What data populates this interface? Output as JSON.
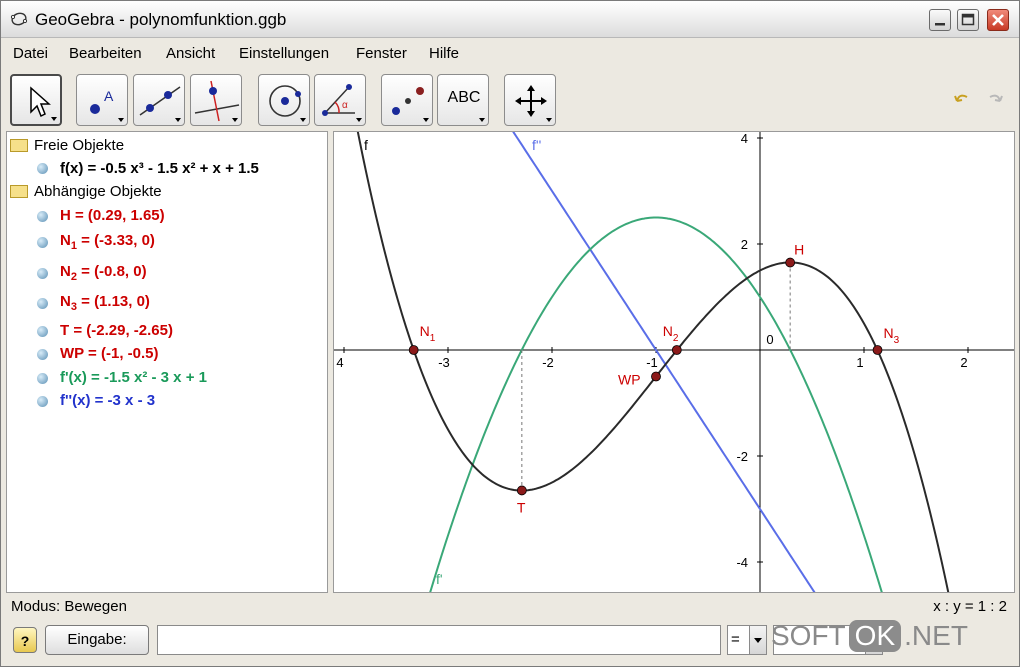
{
  "window": {
    "title": "GeoGebra - polynomfunktion.ggb",
    "controls": [
      "minimize-icon",
      "maximize-icon",
      "close-icon"
    ]
  },
  "menu": [
    "Datei",
    "Bearbeiten",
    "Ansicht",
    "Einstellungen",
    "Fenster",
    "Hilfe"
  ],
  "toolbar": {
    "tools": [
      {
        "icon": "move-arrow-icon"
      },
      {
        "icon": "new-point-icon"
      },
      {
        "icon": "line-through-two-points-icon"
      },
      {
        "icon": "perpendicular-line-icon"
      },
      {
        "icon": "circle-with-center-icon"
      },
      {
        "icon": "angle-icon"
      },
      {
        "icon": "reflect-about-point-icon"
      },
      {
        "icon": "text-icon",
        "label": "ABC"
      },
      {
        "icon": "move-graphics-view-icon"
      }
    ],
    "undo_icon": "undo-icon",
    "redo_icon": "redo-icon"
  },
  "algebra": {
    "free_header": "Freie Objekte",
    "dependent_header": "Abhängige Objekte",
    "free": [
      {
        "name": "f",
        "text": "f(x) = -0.5 x³ - 1.5 x² + x + 1.5",
        "color": "#000000"
      }
    ],
    "dependent": [
      {
        "text": "H = (0.29, 1.65)",
        "color": "#cc0000"
      },
      {
        "text": "N",
        "sub": "1",
        "rest": " = (-3.33, 0)",
        "color": "#cc0000"
      },
      {
        "text": "N",
        "sub": "2",
        "rest": " = (-0.8, 0)",
        "color": "#cc0000"
      },
      {
        "text": "N",
        "sub": "3",
        "rest": " = (1.13, 0)",
        "color": "#cc0000"
      },
      {
        "text": "T = (-2.29, -2.65)",
        "color": "#cc0000"
      },
      {
        "text": "WP = (-1, -0.5)",
        "color": "#cc0000"
      },
      {
        "text": "f'(x) = -1.5 x² - 3 x + 1",
        "color": "#1a9a5a"
      },
      {
        "text": "f''(x) = -3 x - 3",
        "color": "#2233cc"
      }
    ]
  },
  "graph": {
    "x_ticks": [
      "4",
      "-3",
      "-2",
      "-1",
      "0",
      "1",
      "2"
    ],
    "y_ticks": [
      "4",
      "2",
      "0",
      "-2",
      "-4"
    ],
    "curve_labels": {
      "f": "f",
      "f1": "f'",
      "f2": "f''"
    },
    "points": [
      {
        "label": "N",
        "sub": "1",
        "x": -3.33,
        "y": 0
      },
      {
        "label": "N",
        "sub": "2",
        "x": -0.8,
        "y": 0
      },
      {
        "label": "N",
        "sub": "3",
        "x": 1.13,
        "y": 0
      },
      {
        "label": "H",
        "x": 0.29,
        "y": 1.65
      },
      {
        "label": "T",
        "x": -2.29,
        "y": -2.65
      },
      {
        "label": "WP",
        "x": -1,
        "y": -0.5
      }
    ],
    "colors": {
      "f": "#2a2a2a",
      "f1": "#3aa878",
      "f2": "#5a6ee8",
      "point": "#8b1a1a",
      "label": "#cc0000"
    }
  },
  "status": {
    "mode": "Modus: Bewegen",
    "ratio": "x : y = 1 : 2"
  },
  "inputbar": {
    "help_label": "?",
    "button_label": "Eingabe:",
    "input_value": "",
    "combo1_value": "=",
    "combo2_value": ""
  },
  "watermark": {
    "left": "SOFT",
    "mid": "OK",
    "right": ".NET"
  }
}
